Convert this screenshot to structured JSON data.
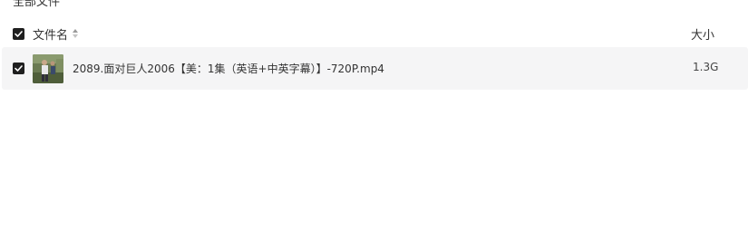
{
  "breadcrumb": {
    "label": "全部文件"
  },
  "header": {
    "name_label": "文件名",
    "size_label": "大小",
    "select_all_checked": true,
    "sort_icon": "sort-icon"
  },
  "files": [
    {
      "name": "2089.面对巨人2006【美：1集（英语+中英字幕）】-720P.mp4",
      "size": "1.3G",
      "checked": true,
      "thumbnail": "video-thumbnail"
    }
  ],
  "colors": {
    "row_background": "#f5f5f6",
    "checkbox": "#1f1f1f",
    "text": "#333333"
  }
}
